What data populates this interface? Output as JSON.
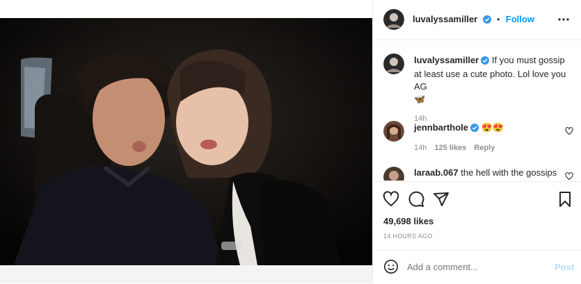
{
  "post": {
    "author": "luvalyssamiller",
    "follow_label": "Follow",
    "separator": "•",
    "more_icon": "more-horizontal-icon"
  },
  "caption": {
    "username": "luvalyssamiller",
    "text": "If you must gossip at least use a cute photo. Lol love you AG",
    "emoji": "🦋",
    "time": "14h"
  },
  "comments": [
    {
      "username": "jennbarthole",
      "text": "😍😍",
      "time": "14h",
      "likes": "125 likes",
      "reply_label": "Reply"
    },
    {
      "username": "laraab.067",
      "text": "the hell with the gossips"
    }
  ],
  "stats": {
    "likes": "49,698 likes",
    "timestamp": "14 HOURS AGO"
  },
  "add_comment": {
    "placeholder": "Add a comment...",
    "post_label": "Post"
  },
  "colors": {
    "accent": "#0095f6",
    "verified": "#3897f0",
    "text": "#262626",
    "muted": "#8e8e8e"
  }
}
